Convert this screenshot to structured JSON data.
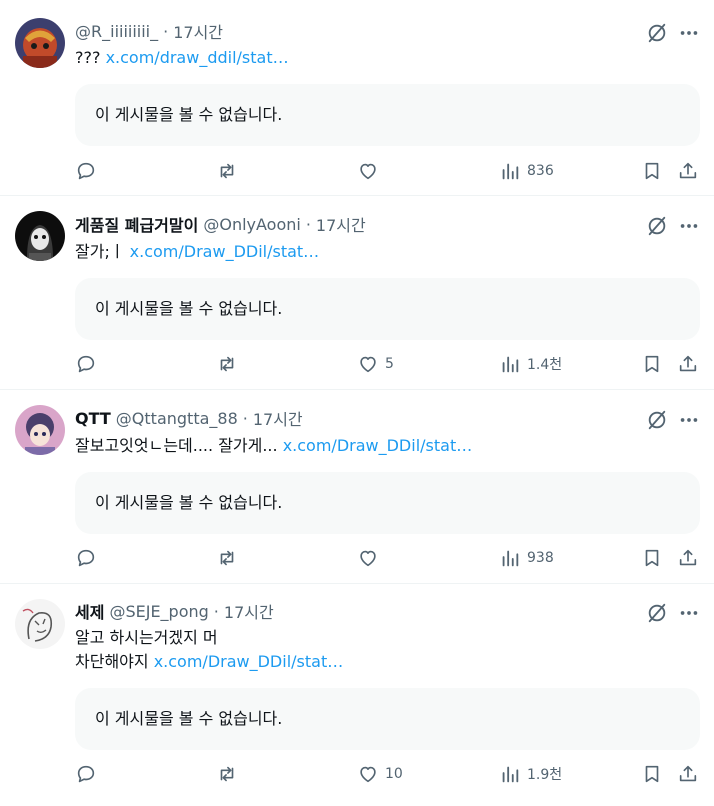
{
  "posts": [
    {
      "name": "",
      "handle": "@R_iiiiiiiii_",
      "time": "17시간",
      "text_prefix": "???",
      "link": "x.com/draw_ddil/stat…",
      "quote": "이 게시물을 볼 수 없습니다.",
      "likes": "",
      "views": "836",
      "avatar_color": "#c24a2a"
    },
    {
      "name": "게품질 폐급거말이",
      "handle": "@OnlyAooni",
      "time": "17시간",
      "text_prefix": "잘가;ㅣ",
      "link": "x.com/Draw_DDil/stat…",
      "quote": "이 게시물을 볼 수 없습니다.",
      "likes": "5",
      "views": "1.4천",
      "avatar_color": "#1a1a1a"
    },
    {
      "name": "QTT",
      "handle": "@Qttangtta_88",
      "time": "17시간",
      "text_prefix": "잘보고잇엇ㄴ는데.... 잘가게...",
      "link": "x.com/Draw_DDil/stat…",
      "quote": "이 게시물을 볼 수 없습니다.",
      "likes": "",
      "views": "938",
      "avatar_color": "#c98ab6"
    },
    {
      "name": "세제",
      "handle": "@SEJE_pong",
      "time": "17시간",
      "text_line1": "알고 하시는거겠지 머",
      "text_prefix": "차단해야지",
      "link": "x.com/Draw_DDil/stat…",
      "quote": "이 게시물을 볼 수 없습니다.",
      "likes": "10",
      "views": "1.9천",
      "avatar_color": "#f2f2f2"
    }
  ],
  "icons": {
    "reply": "reply-icon",
    "repost": "repost-icon",
    "like": "heart-icon",
    "views": "views-icon",
    "bookmark": "bookmark-icon",
    "share": "share-icon",
    "grok": "grok-icon",
    "more": "more-icon"
  },
  "colors": {
    "text": "#0f1419",
    "secondary": "#536471",
    "link": "#1d9bf0",
    "quote_bg": "#f7f9f9",
    "divider": "#eff3f4"
  }
}
